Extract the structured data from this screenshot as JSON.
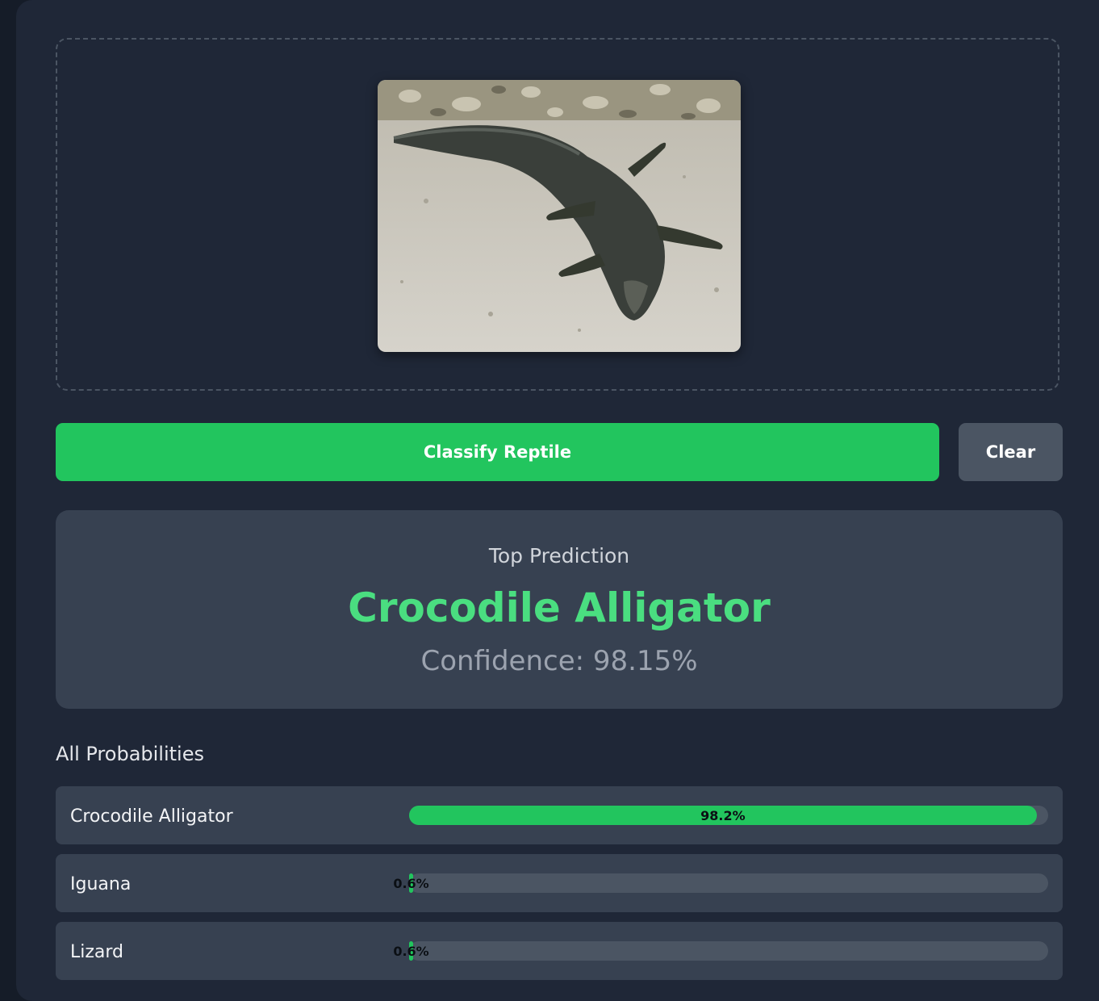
{
  "colors": {
    "accent": "#22c55e",
    "accent_text": "#4ade80",
    "panel": "#374151",
    "background": "#1f2737",
    "secondary_button": "#4b5563"
  },
  "upload": {
    "image_subject": "crocodile on sand"
  },
  "actions": {
    "classify_label": "Classify Reptile",
    "clear_label": "Clear"
  },
  "prediction": {
    "heading": "Top Prediction",
    "class_name": "Crocodile Alligator",
    "confidence_text": "Confidence: 98.15%"
  },
  "probabilities": {
    "title": "All Probabilities",
    "items": [
      {
        "name": "Crocodile Alligator",
        "percent_label": "98.2%",
        "fraction": 0.982
      },
      {
        "name": "Iguana",
        "percent_label": "0.6%",
        "fraction": 0.006
      },
      {
        "name": "Lizard",
        "percent_label": "0.6%",
        "fraction": 0.006
      }
    ]
  }
}
